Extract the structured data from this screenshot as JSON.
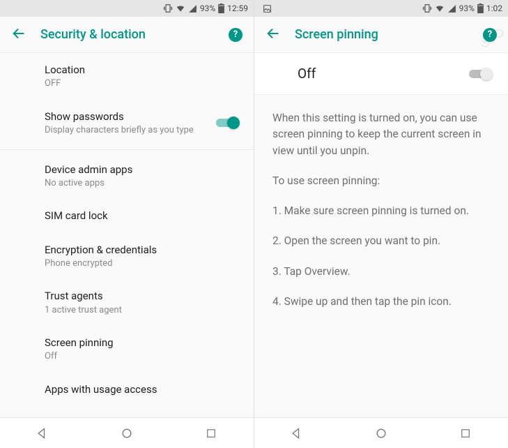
{
  "left": {
    "status": {
      "battery": "93%",
      "time": "12:59"
    },
    "appbar": {
      "title": "Security & location",
      "help": "?"
    },
    "rows": {
      "location": {
        "title": "Location",
        "sub": "OFF"
      },
      "show_passwords": {
        "title": "Show passwords",
        "sub": "Display characters briefly as you type"
      },
      "device_admin": {
        "title": "Device admin apps",
        "sub": "No active apps"
      },
      "sim_lock": {
        "title": "SIM card lock"
      },
      "encryption": {
        "title": "Encryption & credentials",
        "sub": "Phone encrypted"
      },
      "trust_agents": {
        "title": "Trust agents",
        "sub": "1 active trust agent"
      },
      "screen_pinning": {
        "title": "Screen pinning",
        "sub": "Off"
      },
      "usage_access": {
        "title": "Apps with usage access"
      }
    }
  },
  "right": {
    "status": {
      "battery": "93%",
      "time": "1:02"
    },
    "appbar": {
      "title": "Screen pinning",
      "help": "?"
    },
    "off_label": "Off",
    "desc": {
      "p1": "When this setting is turned on, you can use screen pinning to keep the current screen in view until you unpin.",
      "p2": "To use screen pinning:",
      "s1": "1. Make sure screen pinning is turned on.",
      "s2": "2. Open the screen you want to pin.",
      "s3": "3. Tap Overview.",
      "s4": "4. Swipe up and then tap the pin icon."
    }
  }
}
